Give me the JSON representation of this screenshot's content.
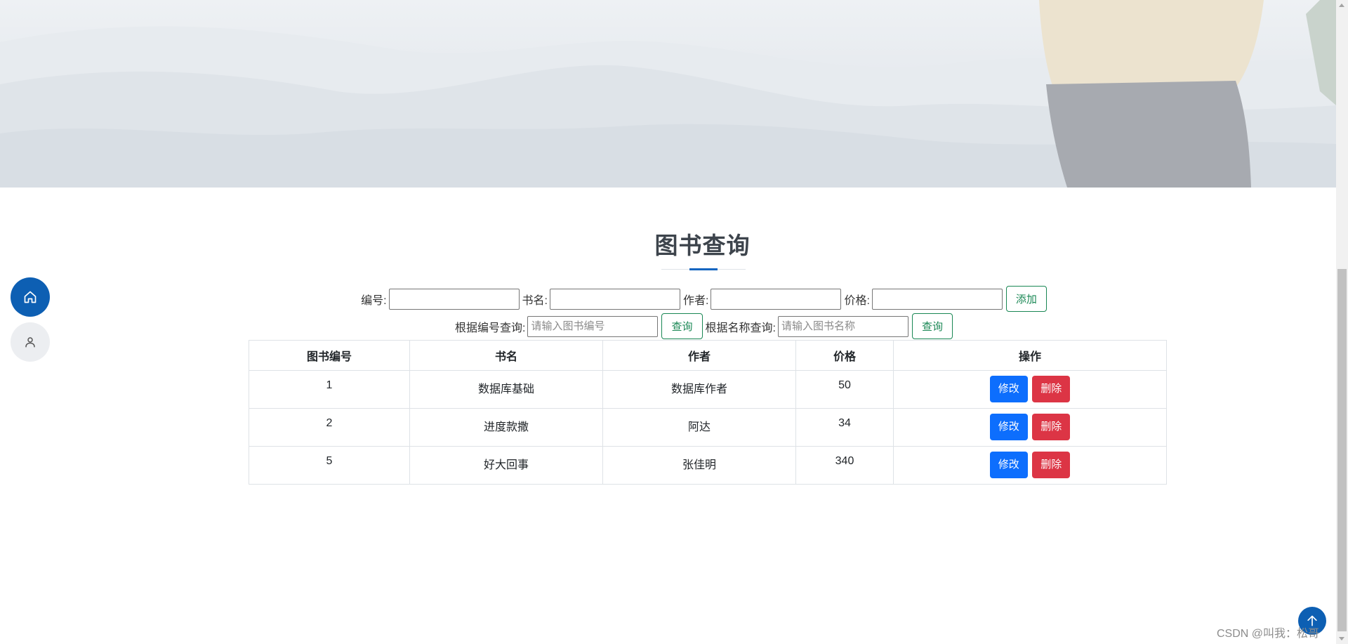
{
  "page": {
    "title": "图书查询"
  },
  "add_form": {
    "id_label": "编号:",
    "name_label": "书名:",
    "author_label": "作者:",
    "price_label": "价格:",
    "id_value": "",
    "name_value": "",
    "author_value": "",
    "price_value": "",
    "add_button": "添加"
  },
  "search_form": {
    "by_id_label": "根据编号查询:",
    "by_id_placeholder": "请输入图书编号",
    "by_id_button": "查询",
    "by_name_label": "根据名称查询:",
    "by_name_placeholder": "请输入图书名称",
    "by_name_button": "查询"
  },
  "table": {
    "headers": [
      "图书编号",
      "书名",
      "作者",
      "价格",
      "操作"
    ],
    "rows": [
      {
        "id": "1",
        "name": "数据库基础",
        "author": "数据库作者",
        "price": "50",
        "edit": "修改",
        "delete": "删除"
      },
      {
        "id": "2",
        "name": "进度款撒",
        "author": "阿达",
        "price": "34",
        "edit": "修改",
        "delete": "删除"
      },
      {
        "id": "5",
        "name": "好大回事",
        "author": "张佳明",
        "price": "340",
        "edit": "修改",
        "delete": "删除"
      }
    ]
  },
  "side_nav": {
    "items": [
      {
        "icon": "home-icon",
        "active": true
      },
      {
        "icon": "user-icon",
        "active": false
      }
    ]
  },
  "watermark": "CSDN @叫我：松哥",
  "colors": {
    "primary": "#0d6efd",
    "danger": "#dc3545",
    "success": "#198754",
    "accent": "#1565c0",
    "nav": "#0d5fb3"
  }
}
